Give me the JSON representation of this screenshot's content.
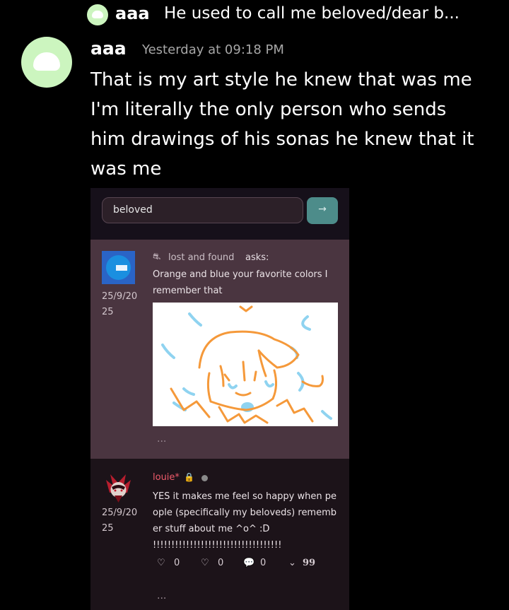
{
  "reply": {
    "author": "aaa",
    "preview": "He used to call me beloved/dear b..."
  },
  "message": {
    "author": "aaa",
    "timestamp": "Yesterday at 09:18 PM",
    "text": "That is my art style he knew that was me I'm literally the only person who sends him drawings of his sonas he knew that it was me"
  },
  "screenshot": {
    "search": {
      "value": "beloved",
      "button_icon": "→"
    },
    "post1": {
      "asker_icon": "⛐",
      "asker": "lost and found",
      "asks_label": "asks:",
      "date_line1": "25/9/20",
      "date_line2": "25",
      "text": "Orange and blue your favorite colors I remember that",
      "more": "..."
    },
    "post2": {
      "author": "louie*",
      "lock_icon": "🔒",
      "date_line1": "25/9/20",
      "date_line2": "25",
      "text": "YES it makes me feel so happy when people (specifically my beloveds) remember stuff about me ^o^ :D !!!!!!!!!!!!!!!!!!!!!!!!!!!!!!!!!!!",
      "like_icon": "♡",
      "like_count": "0",
      "heart_icon": "♡",
      "heart_count": "0",
      "comment_icon": "💬",
      "comment_count": "0",
      "chevron_icon": "⌄",
      "quote_icon": "99",
      "more": "..."
    }
  },
  "colors": {
    "avatar": "#ccf5bf",
    "accent_button": "#4d8c8a",
    "post_highlight": "#4a3540",
    "louie_red": "#ef5b6b"
  }
}
